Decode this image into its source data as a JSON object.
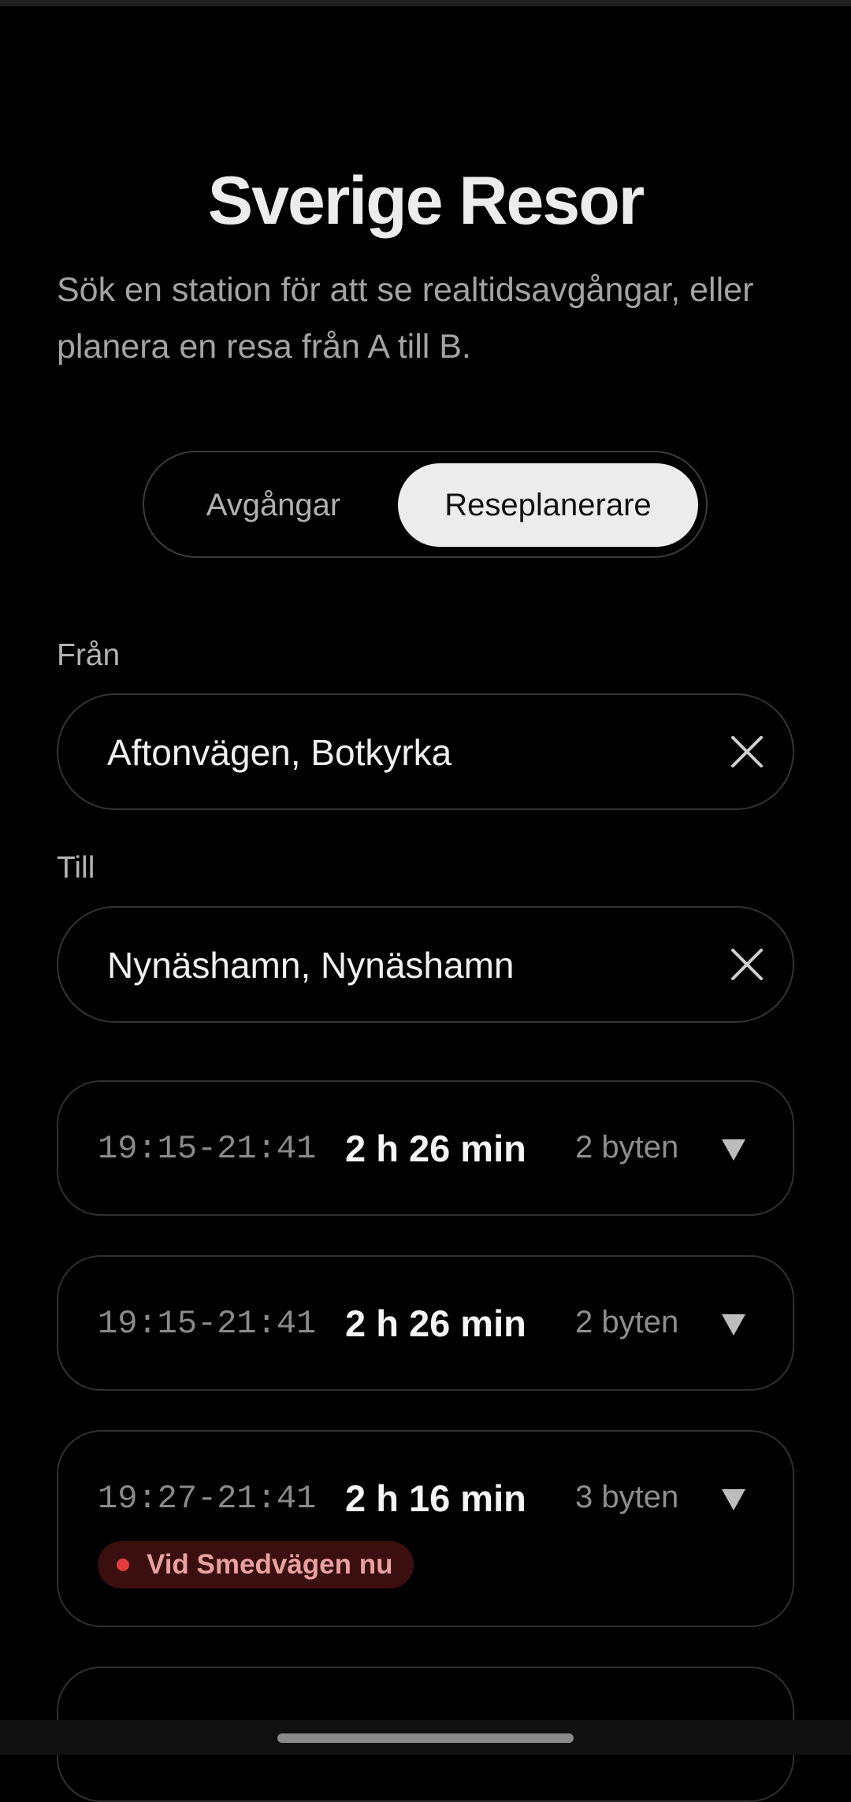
{
  "header": {
    "title": "Sverige Resor",
    "subtitle": "Sök en station för att se realtidsavgångar, eller planera en resa från A till B."
  },
  "mode_tabs": [
    {
      "label": "Avgångar",
      "selected": false
    },
    {
      "label": "Reseplanerare",
      "selected": true
    }
  ],
  "from": {
    "label": "Från",
    "value": "Aftonvägen, Botkyrka"
  },
  "to": {
    "label": "Till",
    "value": "Nynäshamn, Nynäshamn"
  },
  "trips": [
    {
      "time": "19:15-21:41",
      "duration": "2 h 26 min",
      "changes": "2 byten"
    },
    {
      "time": "19:15-21:41",
      "duration": "2 h 26 min",
      "changes": "2 byten"
    },
    {
      "time": "19:27-21:41",
      "duration": "2 h 16 min",
      "changes": "3 byten",
      "alert": "Vid Smedvägen nu"
    }
  ],
  "colors": {
    "background": "#000000",
    "selected_tab": "#ececec",
    "alert_bg": "#3b0f0f",
    "alert_dot": "#e23b3b",
    "alert_text": "#e8a0a0"
  }
}
